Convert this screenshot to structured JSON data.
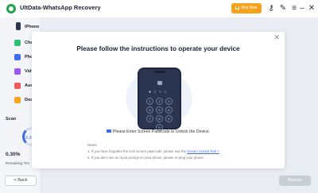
{
  "window": {
    "title": "UltData-WhatsApp Recovery",
    "buy_label": "Buy Now",
    "icons": [
      "key-icon",
      "wrench-icon",
      "menu-icon",
      "minimize-icon",
      "close-icon"
    ]
  },
  "sidebar": {
    "device": "iPhone",
    "items": [
      {
        "label": "Cha",
        "icon": "chat-icon",
        "color": "#2fbf71"
      },
      {
        "label": "Pho",
        "icon": "photo-icon",
        "color": "#3d6bf0"
      },
      {
        "label": "Vid",
        "icon": "video-icon",
        "color": "#9b59f0"
      },
      {
        "label": "Aud",
        "icon": "audio-icon",
        "color": "#f05a5a"
      },
      {
        "label": "Doc",
        "icon": "document-icon",
        "color": "#f6a21d"
      }
    ],
    "scan_label": "Scan",
    "scan_inner": "0.3",
    "scan_percent": "0.30%",
    "remaining": "Remaining Tim"
  },
  "footer": {
    "back_label": "< Back",
    "recover_label": "Recover"
  },
  "modal": {
    "title": "Please follow the instructions to operate your device",
    "passcode_dots": "● ○ ○ ○",
    "keys": [
      "1",
      "2",
      "3",
      "4",
      "5",
      "6",
      "7",
      "8",
      "9",
      "0"
    ],
    "instruction": "Please Enter Screen Passcode to Unlock the Device.",
    "notes_label": "Notes:",
    "note1_prefix": "1. If you have forgotten the lock screen passcode, please use the ",
    "note1_link": "Screen Unlock Tool >",
    "note2": "2. If you don't see an input prompt on your phone, please re-plug your phone."
  }
}
